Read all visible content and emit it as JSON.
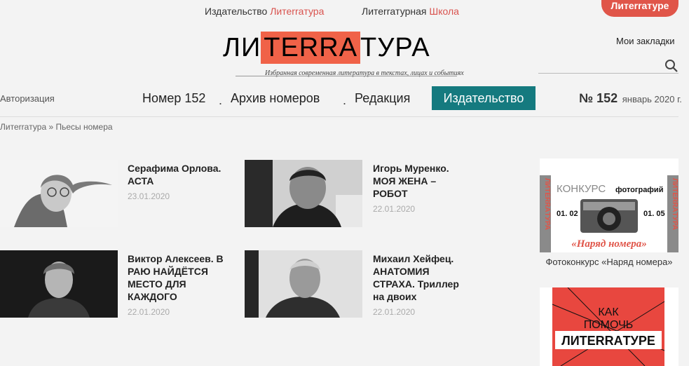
{
  "top_links": {
    "publisher_prefix": "Издательство",
    "publisher_accent": "Литеrraтура",
    "school_prefix": "Литеrraтурная",
    "school_accent": "Школа"
  },
  "red_button": "Литеrraтуре",
  "logo": {
    "left": "ЛИ",
    "mid": "TERRA",
    "right": "ТУРА",
    "tagline": "Избранная современная литература в текстах, лицах и событиях"
  },
  "header": {
    "bookmarks": "Мои закладки",
    "auth": "Авторизация",
    "issue_number": "№ 152",
    "issue_date": "январь 2020 г."
  },
  "nav": {
    "issue": "Номер 152",
    "sep": ".",
    "archive": "Архив номеров",
    "editors": "Редакция",
    "publishing": "Издательство"
  },
  "breadcrumb": {
    "home": "Литеrraтура",
    "sep": "»",
    "current": "Пьесы номера"
  },
  "articles": [
    {
      "title": "Серафима Орлова. АСТА",
      "date": "23.01.2020"
    },
    {
      "title": "Игорь Муренко. МОЯ ЖЕНА – РОБОТ",
      "date": "22.01.2020"
    },
    {
      "title": "Виктор Алексеев. В РАЮ НАЙДЁТСЯ МЕСТО ДЛЯ КАЖДОГО",
      "date": "22.01.2020"
    },
    {
      "title": "Михаил Хейфец. АНАТОМИЯ СТРАХА. Триллер на двоих",
      "date": "22.01.2020"
    }
  ],
  "sidebar": {
    "contest": {
      "side_text": "ЛИТЕRRAТУРА",
      "word1": "КОНКУРС",
      "word2": "фотографий",
      "date_from": "01. 02",
      "date_to": "01. 05",
      "name": "«Наряд номера»",
      "caption": "Фотоконкурс «Наряд номера»"
    },
    "help": {
      "line1": "КАК",
      "line2": "ПОМОЧЬ",
      "line3": "ЛИTERRAТУРЕ"
    }
  },
  "colors": {
    "accent_red": "#e05549",
    "logo_orange": "#f06248",
    "nav_teal": "#157a7f"
  }
}
